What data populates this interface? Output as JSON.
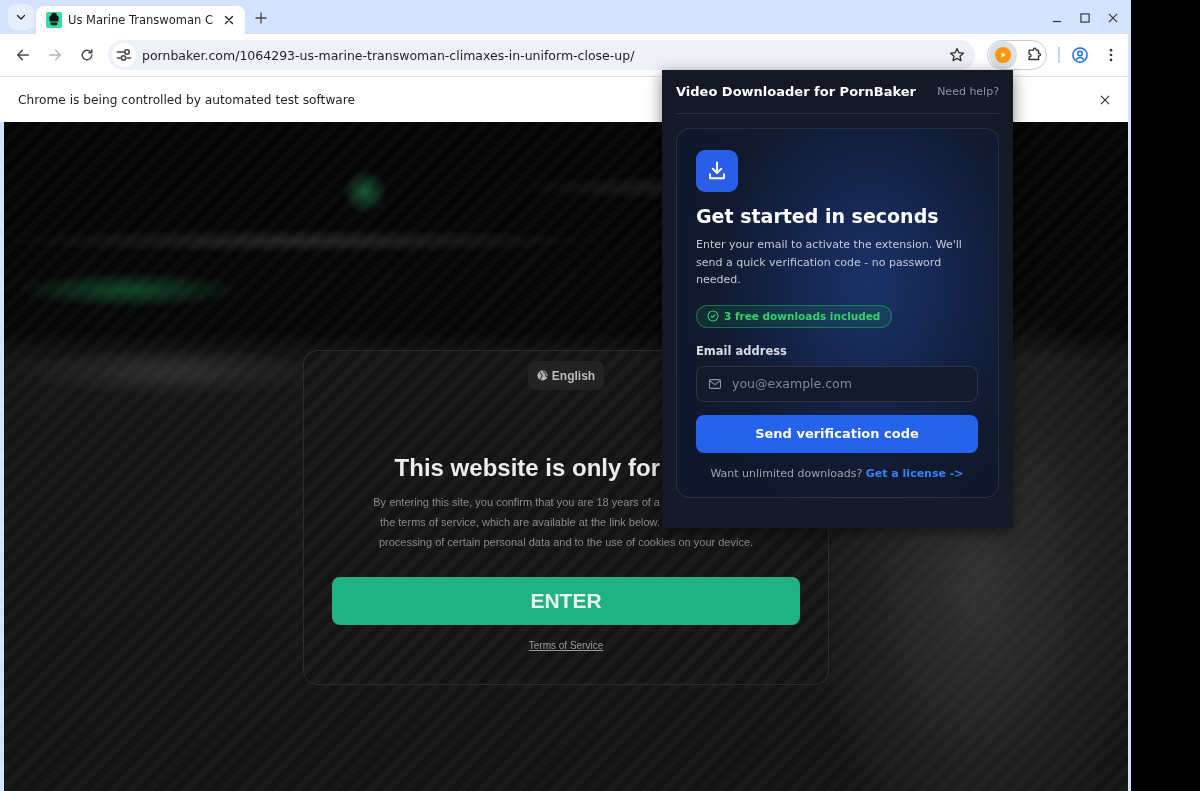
{
  "browser": {
    "tabs": [
      {
        "title": "Us Marine Transwoman C",
        "selected": true
      }
    ],
    "toolbar": {
      "nav": [
        {
          "kind": "back",
          "disabled": false
        },
        {
          "kind": "forward",
          "disabled": true
        },
        {
          "kind": "reload",
          "disabled": false
        }
      ],
      "url": "pornbaker.com/1064293-us-marine-transwoman-climaxes-in-uniform-close-up/",
      "pinned_extensions": [
        {
          "kind": "downloader",
          "selected": true
        }
      ]
    },
    "infobar": {
      "message": "Chrome is being controlled by automated test software"
    }
  },
  "age_gate": {
    "language": "English",
    "heading": "This website is only for",
    "partly_hidden_lines": [
      "By entering this site, you confirm that you are 18 years of a",
      "the terms of service, which are available at the link below."
    ],
    "full_lines": [
      "processing of certain personal data and to the use of cookies on your device."
    ],
    "enter_button": "ENTER",
    "terms_link": "Terms of Service"
  },
  "extension_popup": {
    "title": "Video Downloader for PornBaker",
    "help_link": "Need help?",
    "heading": "Get started in seconds",
    "description": "Enter your email to activate the extension. We'll send a quick verification code - no password needed.",
    "badge": "3 free downloads included",
    "email_label": "Email address",
    "email_placeholder": "you@example.com",
    "submit_button": "Send verification code",
    "footer_text": "Want unlimited downloads?",
    "footer_link": "Get a license ->"
  }
}
